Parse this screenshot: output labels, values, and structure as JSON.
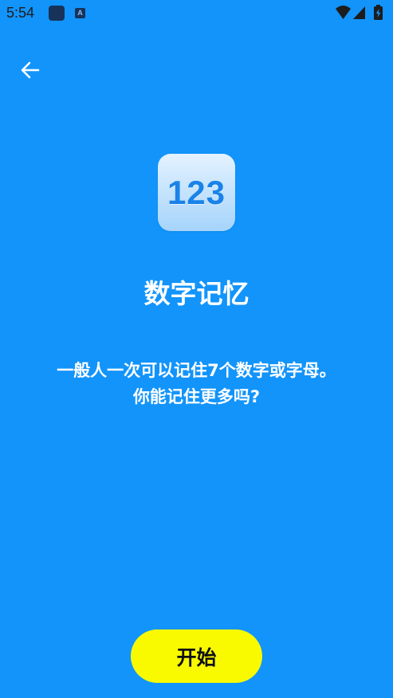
{
  "status_bar": {
    "time": "5:54",
    "a_icon_letter": "A",
    "icons": [
      "app-icon",
      "a-notification-icon",
      "wifi-icon",
      "signal-icon",
      "battery-icon"
    ]
  },
  "nav": {
    "back_icon": "arrow-left-icon"
  },
  "logo": {
    "text": "123"
  },
  "main": {
    "title": "数字记忆",
    "desc_line1": "一般人一次可以记住7个数字或字母。",
    "desc_line2": "你能记住更多吗?"
  },
  "start_button": {
    "label": "开始"
  },
  "colors": {
    "background": "#1294FB",
    "button": "#F9FA00",
    "logo_text": "#1a83e8"
  }
}
